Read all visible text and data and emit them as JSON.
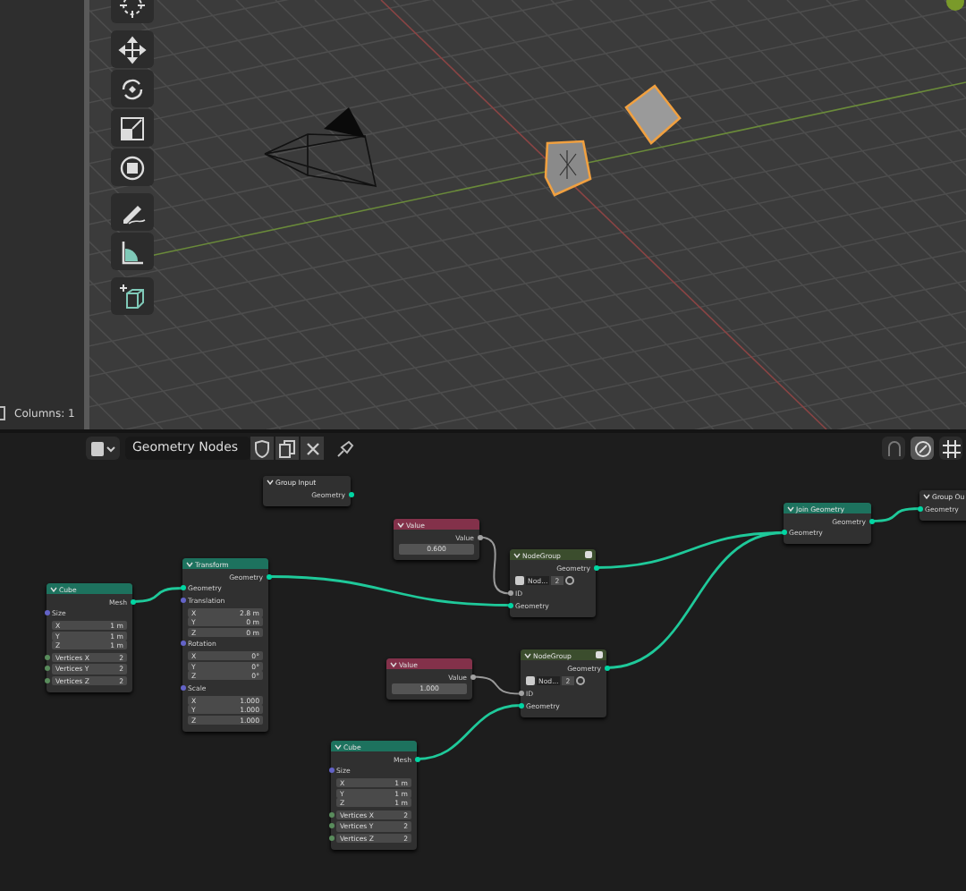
{
  "viewport": {
    "status": "Columns: 1"
  },
  "node_editor": {
    "tree_name": "Geometry Nodes",
    "nodes": [
      {
        "kind": "interface",
        "title": "Group Input",
        "rows": [
          {
            "kind": "output",
            "label": "Geometry",
            "color": "#00d6a3"
          }
        ]
      },
      {
        "kind": "input",
        "title": "Value",
        "rows": [
          {
            "kind": "output",
            "label": "Value",
            "color": "#a1a1a1"
          },
          {
            "kind": "value",
            "value": "0.600"
          }
        ]
      },
      {
        "kind": "geometry",
        "title": "Transform",
        "rows": [
          {
            "kind": "output",
            "label": "Geometry",
            "color": "#00d6a3"
          },
          {
            "kind": "input",
            "label": "Geometry",
            "color": "#00d6a3"
          },
          {
            "kind": "label",
            "label": "Translation",
            "color": "#6363c7"
          },
          {
            "kind": "fields",
            "fields": [
              {
                "label": "X",
                "value": "2.8 m"
              },
              {
                "label": "Y",
                "value": "0 m"
              },
              {
                "label": "Z",
                "value": "0 m"
              }
            ]
          },
          {
            "kind": "label",
            "label": "Rotation",
            "color": "#6363c7"
          },
          {
            "kind": "fields",
            "fields": [
              {
                "label": "X",
                "value": "0°"
              },
              {
                "label": "Y",
                "value": "0°"
              },
              {
                "label": "Z",
                "value": "0°"
              }
            ]
          },
          {
            "kind": "label",
            "label": "Scale",
            "color": "#6363c7"
          },
          {
            "kind": "fields",
            "fields": [
              {
                "label": "X",
                "value": "1.000"
              },
              {
                "label": "Y",
                "value": "1.000"
              },
              {
                "label": "Z",
                "value": "1.000"
              }
            ]
          }
        ]
      },
      {
        "kind": "geometry",
        "title": "Cube",
        "rows": [
          {
            "kind": "output",
            "label": "Mesh",
            "color": "#00d6a3"
          },
          {
            "kind": "label",
            "label": "Size",
            "color": "#6363c7"
          },
          {
            "kind": "fields",
            "fields": [
              {
                "label": "X",
                "value": "1 m"
              },
              {
                "label": "Y",
                "value": "1 m"
              },
              {
                "label": "Z",
                "value": "1 m"
              }
            ]
          },
          {
            "kind": "int",
            "label": "Vertices X",
            "value": "2",
            "color": "#598c5c"
          },
          {
            "kind": "int",
            "label": "Vertices Y",
            "value": "2",
            "color": "#598c5c"
          },
          {
            "kind": "int",
            "label": "Vertices Z",
            "value": "2",
            "color": "#598c5c"
          }
        ]
      },
      {
        "kind": "group",
        "title": "NodeGroup",
        "rows": [
          {
            "kind": "output",
            "label": "Geometry",
            "color": "#00d6a3"
          },
          {
            "kind": "group",
            "name": "Nod...",
            "users": "2"
          },
          {
            "kind": "input",
            "label": "ID",
            "color": "#a1a1a1"
          },
          {
            "kind": "input",
            "label": "Geometry",
            "color": "#00d6a3"
          }
        ]
      },
      {
        "kind": "input",
        "title": "Value",
        "rows": [
          {
            "kind": "output",
            "label": "Value",
            "color": "#a1a1a1"
          },
          {
            "kind": "value",
            "value": "1.000"
          }
        ]
      },
      {
        "kind": "group",
        "title": "NodeGroup",
        "rows": [
          {
            "kind": "output",
            "label": "Geometry",
            "color": "#00d6a3"
          },
          {
            "kind": "group",
            "name": "Nod...",
            "users": "2"
          },
          {
            "kind": "input",
            "label": "ID",
            "color": "#a1a1a1"
          },
          {
            "kind": "input",
            "label": "Geometry",
            "color": "#00d6a3"
          }
        ]
      },
      {
        "kind": "geometry",
        "title": "Cube",
        "rows": [
          {
            "kind": "output",
            "label": "Mesh",
            "color": "#00d6a3"
          },
          {
            "kind": "label",
            "label": "Size",
            "color": "#6363c7"
          },
          {
            "kind": "fields",
            "fields": [
              {
                "label": "X",
                "value": "1 m"
              },
              {
                "label": "Y",
                "value": "1 m"
              },
              {
                "label": "Z",
                "value": "1 m"
              }
            ]
          },
          {
            "kind": "int",
            "label": "Vertices X",
            "value": "2",
            "color": "#598c5c"
          },
          {
            "kind": "int",
            "label": "Vertices Y",
            "value": "2",
            "color": "#598c5c"
          },
          {
            "kind": "int",
            "label": "Vertices Z",
            "value": "2",
            "color": "#598c5c"
          }
        ]
      },
      {
        "kind": "geometry",
        "title": "Join Geometry",
        "rows": [
          {
            "kind": "output",
            "label": "Geometry",
            "color": "#00d6a3"
          },
          {
            "kind": "input",
            "label": "Geometry",
            "color": "#00d6a3"
          }
        ]
      },
      {
        "kind": "interface",
        "title": "Group Ou",
        "rows": [
          {
            "kind": "input",
            "label": "Geometry",
            "color": "#00d6a3"
          }
        ]
      }
    ]
  }
}
